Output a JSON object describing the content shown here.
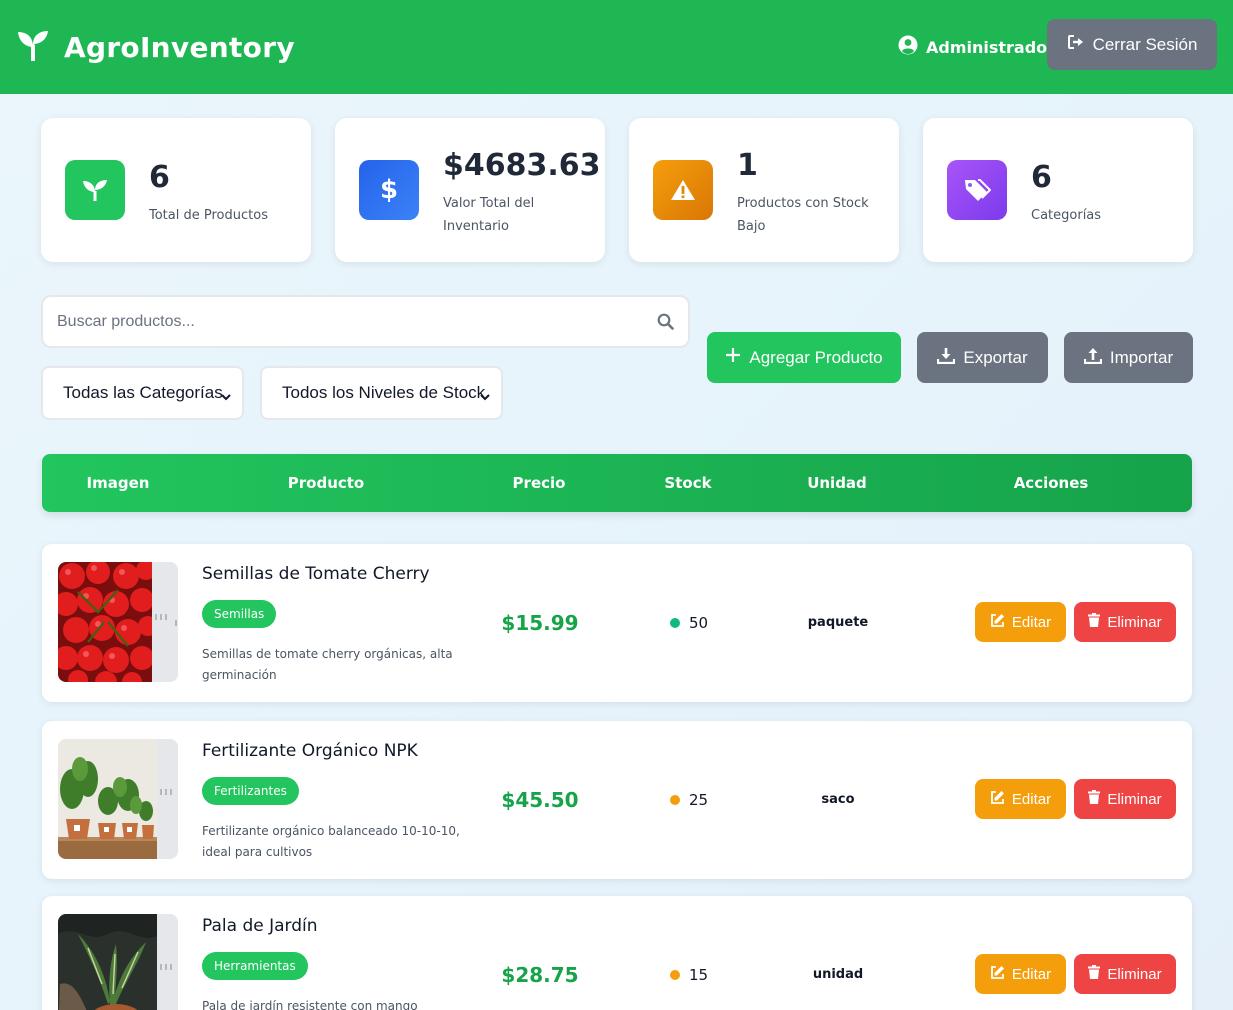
{
  "header": {
    "title": "AgroInventory",
    "user_label": "Administrador",
    "logout_label": "Cerrar Sesión",
    "color": "#1fb654"
  },
  "stats": [
    {
      "value": "6",
      "label": "Total de Productos",
      "icon": "seedling-icon",
      "color": "#22c55e"
    },
    {
      "value": "$4683.63",
      "label": "Valor Total del Inventario",
      "icon": "dollar-icon",
      "color": "#2563eb"
    },
    {
      "value": "1",
      "label": "Productos con Stock Bajo",
      "icon": "warning-icon",
      "color": "#f59e0b"
    },
    {
      "value": "6",
      "label": "Categorías",
      "icon": "tags-icon",
      "color": "#8b5cf6"
    }
  ],
  "search": {
    "placeholder": "Buscar productos...",
    "value": ""
  },
  "filters": {
    "category_selected": "Todas las Categorías",
    "stock_selected": "Todos los Niveles de Stock"
  },
  "actions": {
    "add_label": "Agregar Producto",
    "export_label": "Exportar",
    "import_label": "Importar"
  },
  "table": {
    "headers": [
      "Imagen",
      "Producto",
      "Precio",
      "Stock",
      "Unidad",
      "Acciones"
    ],
    "rows": [
      {
        "name": "Semillas de Tomate Cherry",
        "category": "Semillas",
        "description": "Semillas de tomate cherry orgánicas, alta germinación",
        "price": "$15.99",
        "stock": "50",
        "stock_color": "#10b981",
        "unit": "paquete",
        "image": "tomatoes"
      },
      {
        "name": "Fertilizante Orgánico NPK",
        "category": "Fertilizantes",
        "description": "Fertilizante orgánico balanceado 10-10-10, ideal para cultivos",
        "price": "$45.50",
        "stock": "25",
        "stock_color": "#f59e0b",
        "unit": "saco",
        "image": "potted-plants"
      },
      {
        "name": "Pala de Jardín",
        "category": "Herramientas",
        "description": "Pala de jardín resistente con mango",
        "price": "$28.75",
        "stock": "15",
        "stock_color": "#f59e0b",
        "unit": "unidad",
        "image": "plant-in-hands"
      }
    ],
    "edit_label": "Editar",
    "delete_label": "Eliminar"
  }
}
